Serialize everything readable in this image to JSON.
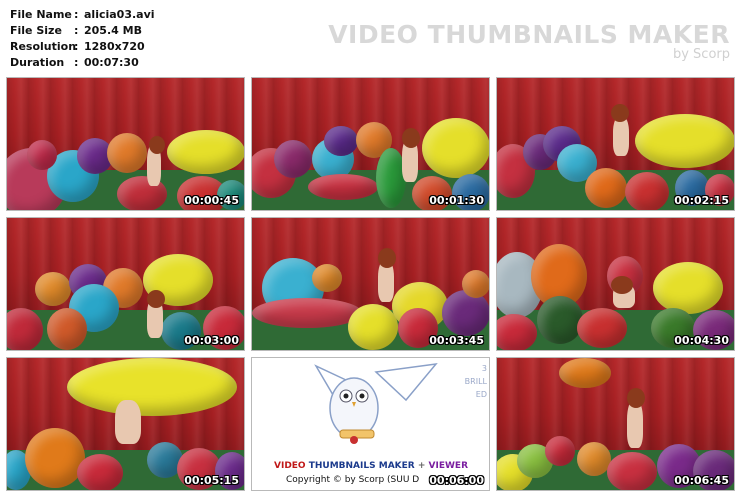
{
  "info": {
    "rows": [
      {
        "label": "File Name",
        "value": "alicia03.avi"
      },
      {
        "label": "File Size",
        "value": "205.4 MB"
      },
      {
        "label": "Resolution",
        "value": "1280x720"
      },
      {
        "label": "Duration",
        "value": "00:07:30"
      }
    ],
    "separator": ":"
  },
  "brand": {
    "title": "VIDEO THUMBNAILS MAKER",
    "subtitle": "by Scorp"
  },
  "thumbnails": [
    {
      "time": "00:00:45"
    },
    {
      "time": "00:01:30"
    },
    {
      "time": "00:02:15"
    },
    {
      "time": "00:03:00"
    },
    {
      "time": "00:03:45"
    },
    {
      "time": "00:04:30"
    },
    {
      "time": "00:05:15"
    },
    {
      "time": "00:06:00"
    },
    {
      "time": "00:06:45"
    }
  ],
  "ad": {
    "w1": "VIDEO",
    "w2": "THUMBNAILS",
    "w3": "MAKER",
    "plus": "+",
    "w4": "VIEWER",
    "copyright": "Copyright © by Scorp (SUU D",
    "side1": "3",
    "side2": "BRILL",
    "side3": "ED"
  },
  "colors": {
    "curtain": "#a51f22",
    "floor": "#2f6a35",
    "timestamp": "#ffffff"
  }
}
